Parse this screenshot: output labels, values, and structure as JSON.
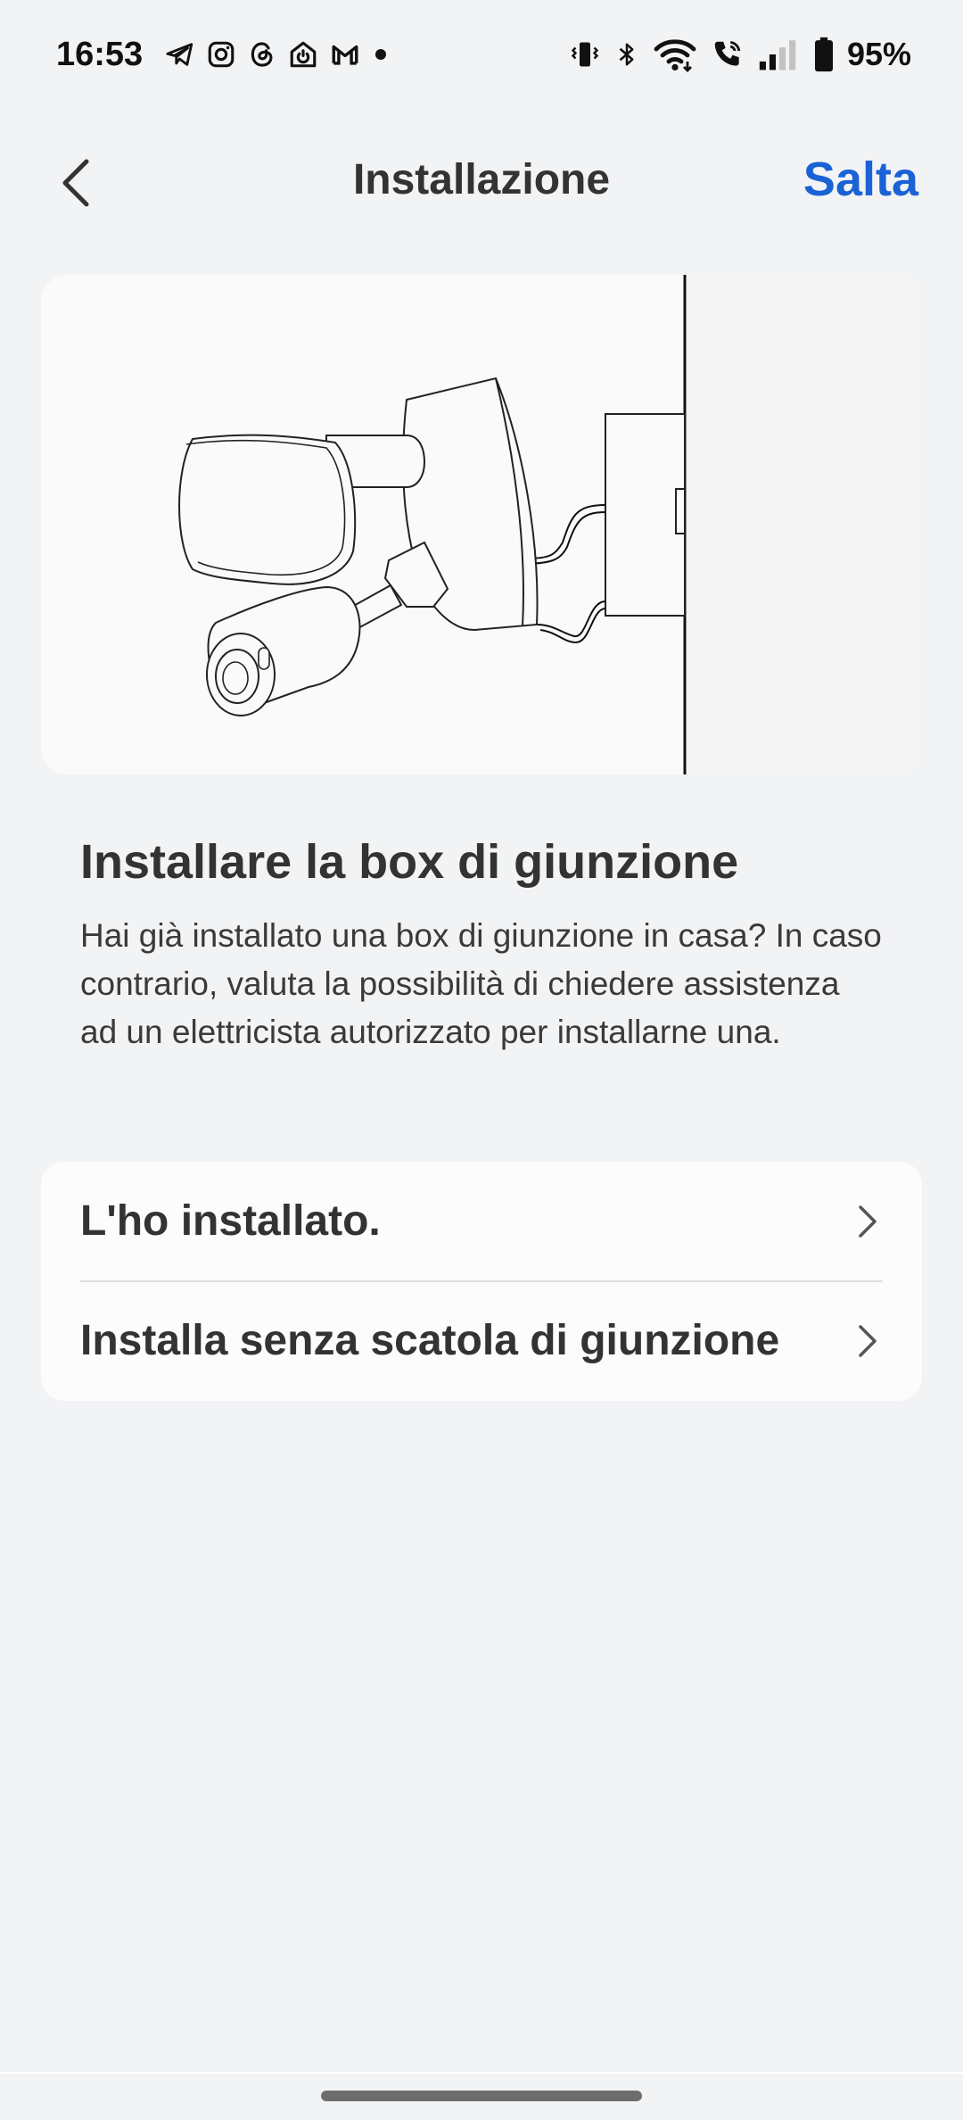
{
  "status_bar": {
    "time": "16:53",
    "battery_percent": "95%",
    "left_icons": [
      "telegram-icon",
      "instagram-icon",
      "threads-icon",
      "home-app-icon",
      "gmail-icon",
      "dot-icon"
    ],
    "right_icons": [
      "vibrate-icon",
      "bluetooth-icon",
      "wifi-icon",
      "wifi-call-icon",
      "signal-icon",
      "battery-icon"
    ]
  },
  "header": {
    "title": "Installazione",
    "skip_label": "Salta"
  },
  "content": {
    "title": "Installare la box di giunzione",
    "body": "Hai già installato una box di giunzione in casa? In caso contrario, valuta la possibilità di chiedere assistenza ad un elettricista autorizzato per installarne una."
  },
  "options": [
    {
      "label": "L'ho installato."
    },
    {
      "label": "Installa senza scatola di giunzione"
    }
  ],
  "colors": {
    "accent": "#1a62d6",
    "background": "#f2f3f5",
    "card": "#fafafa"
  }
}
